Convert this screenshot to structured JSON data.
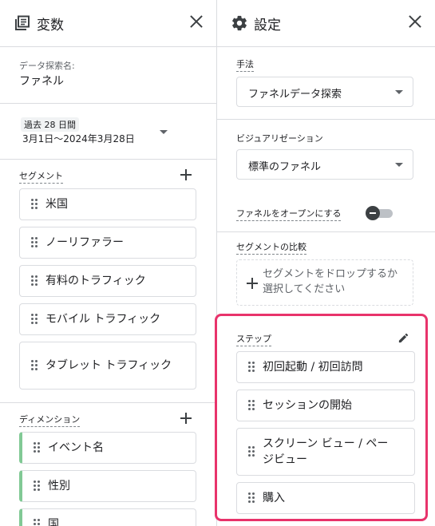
{
  "variables_panel": {
    "title": "変数",
    "exploration_name_label": "データ探索名:",
    "exploration_name": "ファネル",
    "date_range": {
      "badge": "過去 28 日間",
      "range": "3月1日～2024年3月28日"
    },
    "segments_label": "セグメント",
    "segments": [
      "米国",
      "ノーリファラー",
      "有料のトラフィック",
      "モバイル トラフィック",
      "タブレット トラフィック"
    ],
    "dimensions_label": "ディメンション",
    "dimensions": [
      "イベント名",
      "性別",
      "国"
    ]
  },
  "settings_panel": {
    "title": "設定",
    "technique_label": "手法",
    "technique_value": "ファネルデータ探索",
    "visualization_label": "ビジュアリゼーション",
    "visualization_value": "標準のファネル",
    "open_funnel_label": "ファネルをオープンにする",
    "open_funnel_on": false,
    "segment_compare_label": "セグメントの比較",
    "segment_drop_text": "セグメントをドロップするか選択してください",
    "steps_label": "ステップ",
    "steps": [
      "初回起動 / 初回訪問",
      "セッションの開始",
      "スクリーン ビュー / ページビュー",
      "購入"
    ]
  },
  "colors": {
    "highlight": "#e8336b",
    "dimension_accent": "#81c995"
  }
}
